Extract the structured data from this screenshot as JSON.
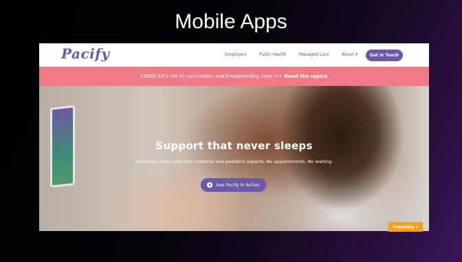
{
  "slide": {
    "title": "Mobile Apps"
  },
  "site": {
    "logo": "Pacify",
    "nav": {
      "items": [
        "Employers",
        "Public Health",
        "Managed Care",
        "About"
      ],
      "cta": "Get in Touch"
    },
    "banner": {
      "text": "COVID-19's risk to vaccination and breastfeeding rates >>",
      "link": "Read the report"
    },
    "hero": {
      "title": "Support that never sleeps",
      "subtitle": "Unlimited video calls with maternal and pediatric experts. No appointments. No waiting.",
      "button": "See Pacify in Action"
    }
  },
  "translate_button": "Translate »",
  "colors": {
    "brand_purple": "#6b59a8",
    "banner_pink": "#f07b86",
    "translate_orange": "#f2a01e"
  }
}
